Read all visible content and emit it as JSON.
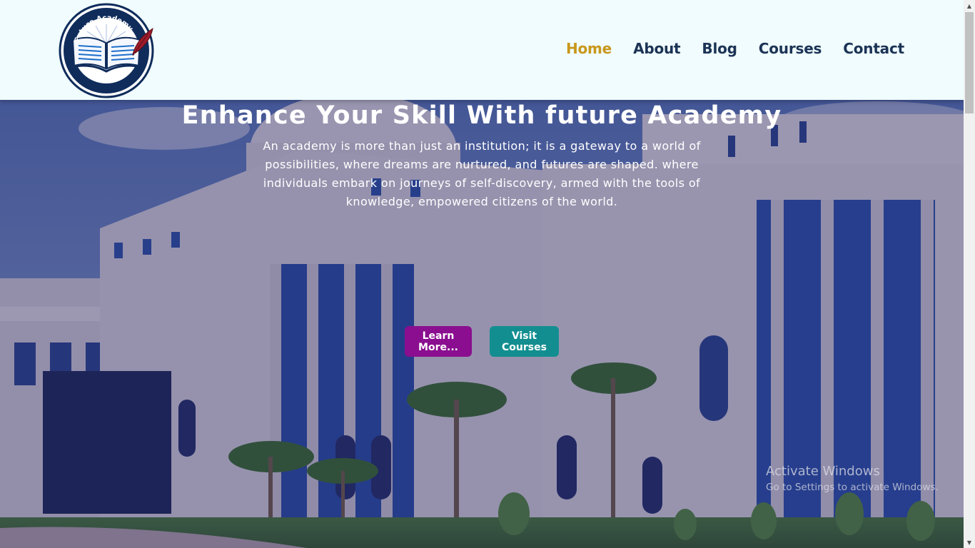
{
  "header": {
    "logo_text": "Future Academy",
    "nav": [
      {
        "label": "Home",
        "active": true
      },
      {
        "label": "About",
        "active": false
      },
      {
        "label": "Blog",
        "active": false
      },
      {
        "label": "Courses",
        "active": false
      },
      {
        "label": "Contact",
        "active": false
      }
    ]
  },
  "hero": {
    "title": "Enhance Your Skill With future Academy",
    "description": "An academy is more than just an institution; it is a gateway to a world of possibilities, where dreams are nurtured, and futures are shaped. where individuals embark on journeys of self-discovery, armed with the tools of knowledge, empowered citizens of the world.",
    "learn_button": "Learn More...",
    "courses_button": "Visit Courses"
  },
  "watermark": {
    "title": "Activate Windows",
    "subtitle": "Go to Settings to activate Windows."
  },
  "colors": {
    "accent_active": "#c9971b",
    "nav_text": "#1b3355",
    "learn_button": "#8a0e8f",
    "courses_button": "#138e90",
    "header_bg": "#f0fcfd"
  },
  "icons": {
    "logo": "open-book-with-quill-icon",
    "scroll_up": "triangle-up-icon",
    "scroll_down": "triangle-down-icon"
  }
}
